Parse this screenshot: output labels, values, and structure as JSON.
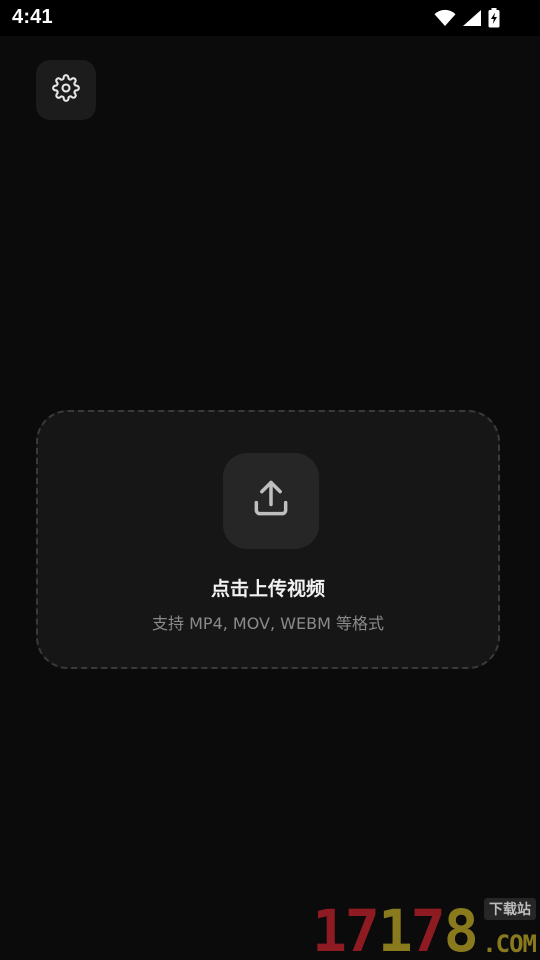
{
  "status_bar": {
    "time": "4:41",
    "icons": [
      "wifi-icon",
      "cellular-signal-icon",
      "battery-charging-icon"
    ]
  },
  "toolbar": {
    "settings_icon": "gear-icon"
  },
  "upload": {
    "icon": "upload-icon",
    "title": "点击上传视频",
    "subtitle": "支持 MP4, MOV, WEBM 等格式"
  },
  "watermark": {
    "number_red_1": "17",
    "number_gold_1": "1",
    "number_red_2": "7",
    "number_gold_2": "8",
    "tag": "下载站",
    "domain": ".COM"
  },
  "colors": {
    "background": "#0b0b0b",
    "card": "#161616",
    "icon_box": "#262626",
    "subtitle": "#8a8a8a"
  }
}
